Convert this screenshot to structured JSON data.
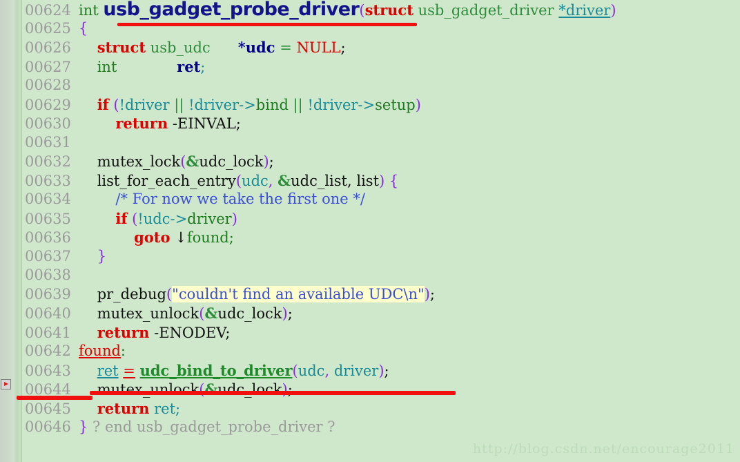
{
  "editor": {
    "background_color": "#cfe8cc",
    "gutter_color": "#c9d4c8",
    "line_number_color": "#9a9a9a",
    "annotation_color": "#f01010",
    "string_highlight_color": "#ffffcc"
  },
  "gutter_marker": {
    "icon": "bookmark-marker-icon",
    "line": "00643"
  },
  "watermark": {
    "text": "http://blog.csdn.net/encourage2011"
  },
  "lines": [
    {
      "num": "00624",
      "text": "int usb_gadget_probe_driver(struct usb_gadget_driver *driver)"
    },
    {
      "num": "00625",
      "text": "{"
    },
    {
      "num": "00626",
      "text": "    struct usb_udc      *udc = NULL;"
    },
    {
      "num": "00627",
      "text": "    int             ret;"
    },
    {
      "num": "00628",
      "text": ""
    },
    {
      "num": "00629",
      "text": "    if (!driver || !driver->bind || !driver->setup)"
    },
    {
      "num": "00630",
      "text": "        return -EINVAL;"
    },
    {
      "num": "00631",
      "text": ""
    },
    {
      "num": "00632",
      "text": "    mutex_lock(&udc_lock);"
    },
    {
      "num": "00633",
      "text": "    list_for_each_entry(udc, &udc_list, list) {"
    },
    {
      "num": "00634",
      "text": "        /* For now we take the first one */"
    },
    {
      "num": "00635",
      "text": "        if (!udc->driver)"
    },
    {
      "num": "00636",
      "text": "            goto ↓found;"
    },
    {
      "num": "00637",
      "text": "    }"
    },
    {
      "num": "00638",
      "text": ""
    },
    {
      "num": "00639",
      "text": "    pr_debug(\"couldn't find an available UDC\\n\");"
    },
    {
      "num": "00640",
      "text": "    mutex_unlock(&udc_lock);"
    },
    {
      "num": "00641",
      "text": "    return -ENODEV;"
    },
    {
      "num": "00642",
      "text": "found:"
    },
    {
      "num": "00643",
      "text": "    ret = udc_bind_to_driver(udc, driver);"
    },
    {
      "num": "00644",
      "text": "    mutex_unlock(&udc_lock);"
    },
    {
      "num": "00645",
      "text": "    return ret;"
    },
    {
      "num": "00646",
      "text": "} ? end usb_gadget_probe_driver ?"
    }
  ],
  "tokens": {
    "l624": {
      "kw_int": "int",
      "name": "usb_gadget_probe_driver",
      "open": "(",
      "kw_struct": "struct",
      "type": "usb_gadget_driver",
      "star_driver": "*driver",
      "close": ")"
    },
    "l625": {
      "brace": "{"
    },
    "l626": {
      "kw": "struct",
      "type": "usb_udc",
      "var": "*udc",
      "eq": "=",
      "val": "NULL",
      "semi": ";"
    },
    "l627": {
      "type": "int",
      "var": "ret",
      "semi": ";"
    },
    "l629": {
      "kw": "if",
      "open": "(",
      "a": "!driver",
      "or1": "||",
      "b": "!driver->",
      "bind": "bind",
      "or2": "||",
      "c": "!driver->",
      "setup": "setup",
      "close": ")"
    },
    "l630": {
      "kw": "return",
      "val": "-EINVAL",
      "semi": ";"
    },
    "l632": {
      "fn": "mutex_lock",
      "open": "(",
      "amp": "&",
      "arg": "udc_lock",
      "close": ")",
      "semi": ";"
    },
    "l633": {
      "fn": "list_for_each_entry",
      "open": "(",
      "a": "udc",
      "comma1": ", ",
      "amp": "&",
      "b": "udc_list",
      "comma2": ", ",
      "c": "list",
      "close": ")",
      "brace": " {"
    },
    "l634": {
      "comment": "/* For now we take the first one */"
    },
    "l635": {
      "kw": "if",
      "open": "(",
      "expr": "!udc->",
      "field": "driver",
      "close": ")"
    },
    "l636": {
      "kw": "goto",
      "arrow": "↓",
      "label": "found",
      "semi": ";"
    },
    "l637": {
      "brace": "}"
    },
    "l639": {
      "fn": "pr_debug",
      "open": "(",
      "string": "\"couldn't find an available UDC\\n\"",
      "close": ")",
      "semi": ";"
    },
    "l640": {
      "fn": "mutex_unlock",
      "open": "(",
      "amp": "&",
      "arg": "udc_lock",
      "close": ")",
      "semi": ";"
    },
    "l641": {
      "kw": "return",
      "val": "-ENODEV",
      "semi": ";"
    },
    "l642": {
      "label": "found",
      "colon": ":"
    },
    "l643": {
      "ret": "ret",
      "eq": "=",
      "fn": "udc_bind_to_driver",
      "open": "(",
      "a": "udc",
      "comma": ", ",
      "b": "driver",
      "close": ")",
      "semi": ";"
    },
    "l644": {
      "fn": "mutex_unlock",
      "open": "(",
      "amp": "&",
      "arg": "udc_lock",
      "close": ")",
      "semi": ";"
    },
    "l645": {
      "kw": "return",
      "val": "ret",
      "semi": ";"
    },
    "l646": {
      "brace": "}",
      "note": " ? end usb_gadget_probe_driver ?"
    }
  }
}
